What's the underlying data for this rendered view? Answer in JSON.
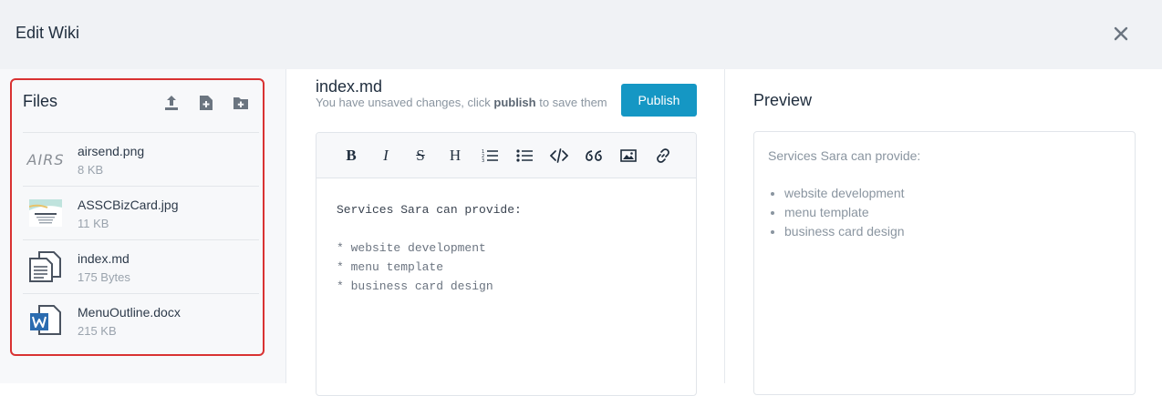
{
  "header": {
    "title": "Edit Wiki",
    "close_icon": "close-icon"
  },
  "files": {
    "title": "Files",
    "actions": [
      {
        "icon": "upload-icon"
      },
      {
        "icon": "new-file-icon"
      },
      {
        "icon": "new-folder-icon"
      }
    ],
    "items": [
      {
        "name": "airsend.png",
        "size": "8 KB",
        "thumb_text": "AIRS",
        "icon": "image-thumbnail"
      },
      {
        "name": "ASSCBizCard.jpg",
        "size": "11 KB",
        "icon": "image-thumbnail"
      },
      {
        "name": "index.md",
        "size": "175 Bytes",
        "icon": "document-icon"
      },
      {
        "name": "MenuOutline.docx",
        "size": "215 KB",
        "icon": "word-document-icon"
      }
    ]
  },
  "editor": {
    "file_name": "index.md",
    "note_before": "You have unsaved changes, click ",
    "note_bold": "publish",
    "note_after": " to save them",
    "publish_label": "Publish",
    "toolbar": [
      {
        "icon": "bold-icon",
        "glyph": "B"
      },
      {
        "icon": "italic-icon",
        "glyph": "I"
      },
      {
        "icon": "strikethrough-icon",
        "glyph": "S"
      },
      {
        "icon": "heading-icon",
        "glyph": "H"
      },
      {
        "icon": "ordered-list-icon"
      },
      {
        "icon": "unordered-list-icon"
      },
      {
        "icon": "code-icon"
      },
      {
        "icon": "quote-icon"
      },
      {
        "icon": "image-icon"
      },
      {
        "icon": "link-icon"
      }
    ],
    "content_lines": [
      "Services Sara can provide:",
      "",
      "* website development",
      "* menu template",
      "* business card design"
    ]
  },
  "preview": {
    "title": "Preview",
    "intro": "Services Sara can provide:",
    "items": [
      "website development",
      "menu template",
      "business card design"
    ]
  },
  "colors": {
    "accent": "#1597c4",
    "highlight_border": "#d93232"
  }
}
